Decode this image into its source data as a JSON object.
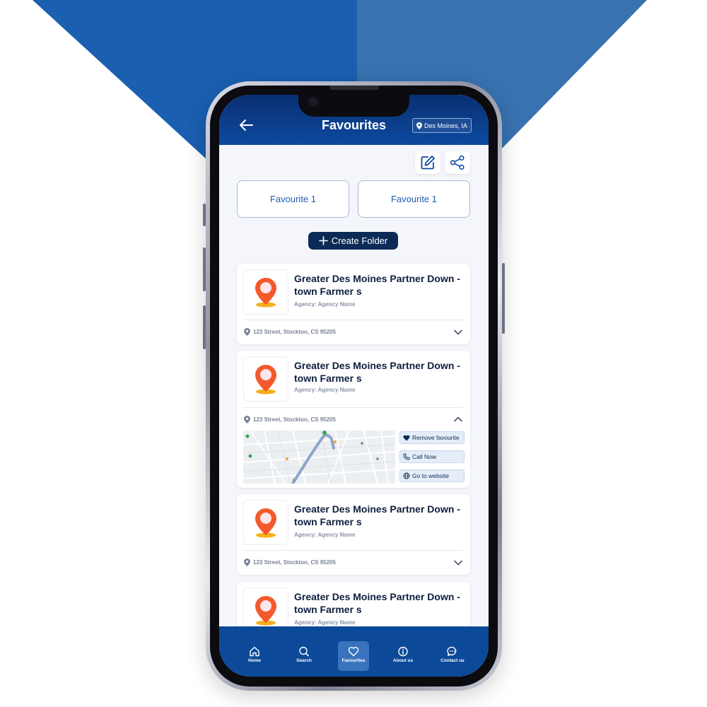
{
  "header": {
    "title": "Favourites",
    "location": "Des Moines, IA"
  },
  "folders": [
    "Favourite 1",
    "Favourite 1"
  ],
  "create_folder_label": "Create Folder",
  "listings": [
    {
      "title": "Greater Des Moines Partner Down - town Farmer s",
      "agency": "Agency: Agency Name",
      "address": "123 Street, Stockton, CS 95205",
      "expanded": false
    },
    {
      "title": "Greater Des Moines Partner Down - town Farmer s",
      "agency": "Agency: Agency Name",
      "address": "123 Street, Stockton, CS 95205",
      "expanded": true
    },
    {
      "title": "Greater Des Moines Partner Down - town Farmer s",
      "agency": "Agency: Agency Name",
      "address": "123 Street, Stockton, CS 95205",
      "expanded": false
    },
    {
      "title": "Greater Des Moines Partner Down - town Farmer s",
      "agency": "Agency: Agency Name"
    }
  ],
  "actions": {
    "remove_favourite": "Remove favourite",
    "call_now": "Call Now",
    "go_to_website": "Go to website"
  },
  "nav": [
    {
      "label": "Home",
      "icon": "home-icon"
    },
    {
      "label": "Search",
      "icon": "search-icon"
    },
    {
      "label": "Favourites",
      "icon": "heart-icon",
      "active": true
    },
    {
      "label": "About us",
      "icon": "info-icon"
    },
    {
      "label": "Contact us",
      "icon": "chat-icon"
    }
  ],
  "colors": {
    "header": "#0d4aa0",
    "nav": "#0c4a99",
    "primary_dark": "#0c2a56",
    "accent_pin": "#f4592b",
    "bg_left": "#1a5fb0",
    "bg_right": "#3872b0"
  }
}
